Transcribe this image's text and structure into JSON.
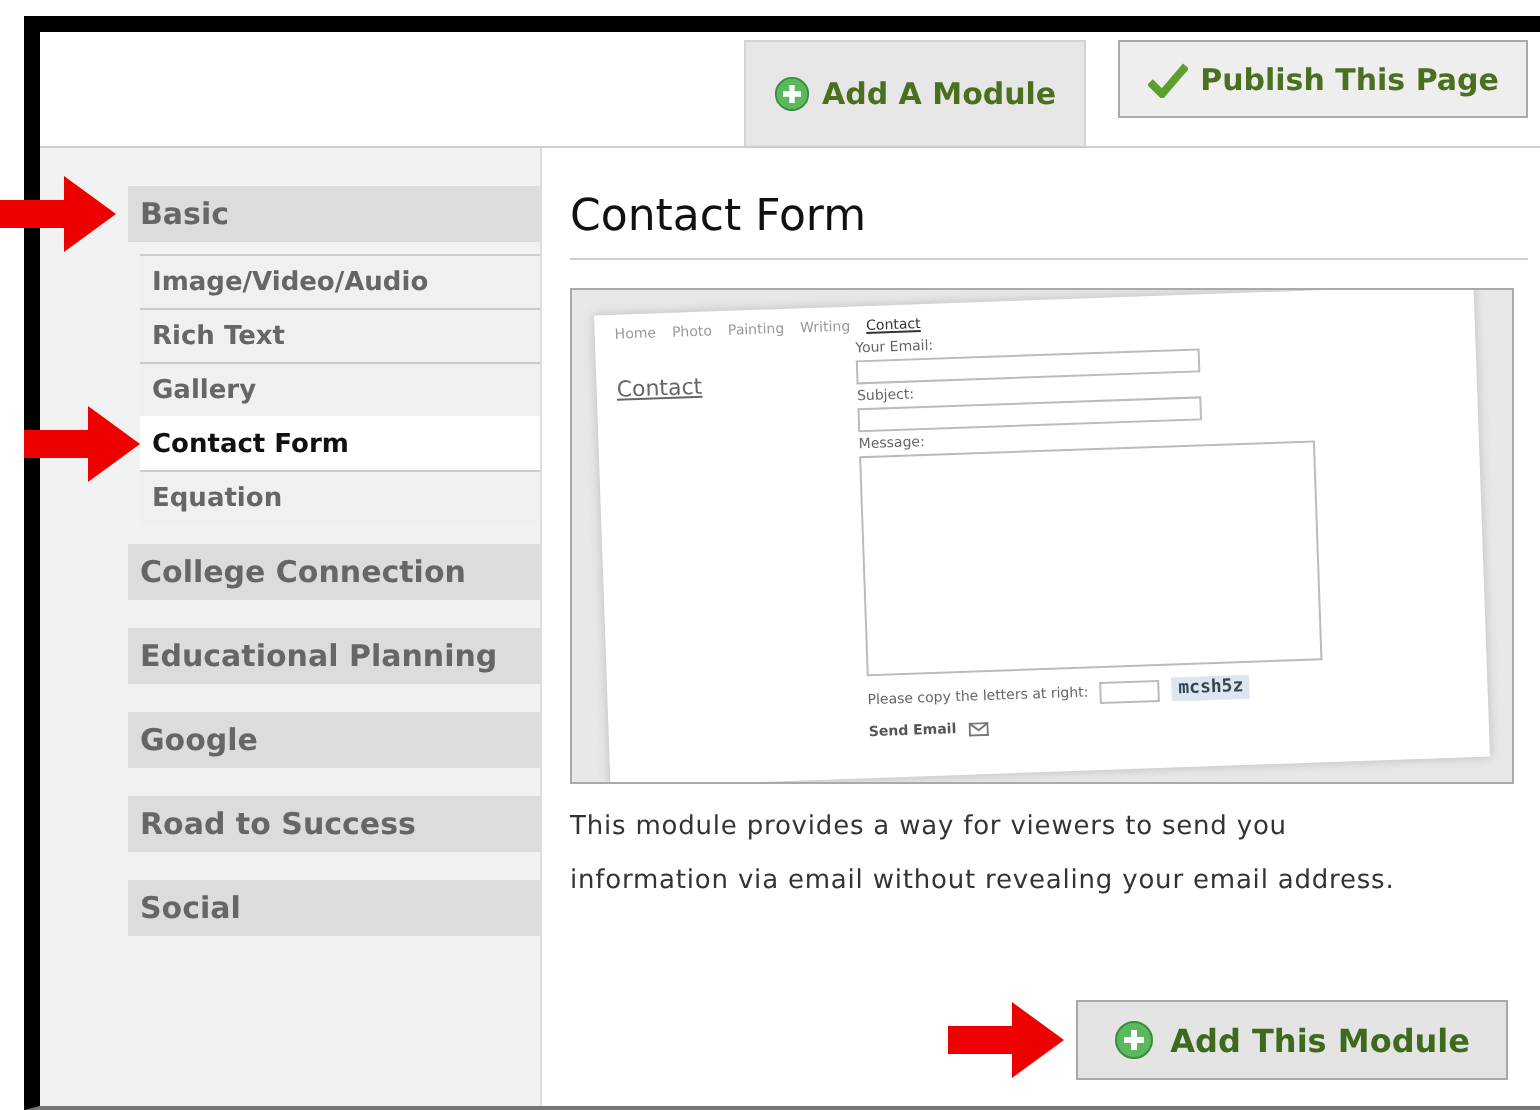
{
  "header_tabs": [
    {
      "label": "Add A Module",
      "selected": true
    },
    {
      "label": "Publish This Page",
      "selected": false
    }
  ],
  "sidebar": {
    "categories": [
      {
        "label": "Basic",
        "marked": true,
        "children": [
          {
            "label": "Image/Video/Audio",
            "selected": false,
            "marked": false
          },
          {
            "label": "Rich Text",
            "selected": false,
            "marked": false
          },
          {
            "label": "Gallery",
            "selected": false,
            "marked": false
          },
          {
            "label": "Contact Form",
            "selected": true,
            "marked": true
          },
          {
            "label": "Equation",
            "selected": false,
            "marked": false
          }
        ]
      },
      {
        "label": "College Connection",
        "marked": false
      },
      {
        "label": "Educational Planning",
        "marked": false
      },
      {
        "label": "Google",
        "marked": false
      },
      {
        "label": "Road to Success",
        "marked": false
      },
      {
        "label": "Social",
        "marked": false
      }
    ]
  },
  "module": {
    "title": "Contact Form",
    "preview": {
      "nav": [
        {
          "label": "Home",
          "selected": false
        },
        {
          "label": "Photo",
          "selected": false
        },
        {
          "label": "Painting",
          "selected": false
        },
        {
          "label": "Writing",
          "selected": false
        },
        {
          "label": "Contact",
          "selected": true
        }
      ],
      "heading": "Contact",
      "fields": [
        {
          "label": "Your Email:",
          "kind": "line"
        },
        {
          "label": "Subject:",
          "kind": "line"
        },
        {
          "label": "Message:",
          "kind": "area"
        }
      ],
      "captcha_label": "Please copy the letters at right:",
      "captcha": "mcsh5z",
      "send": "Send Email"
    },
    "description": "This module provides a way for viewers to send you information via email without revealing your email address.",
    "button": {
      "label": "Add This Module",
      "marked": true
    }
  }
}
